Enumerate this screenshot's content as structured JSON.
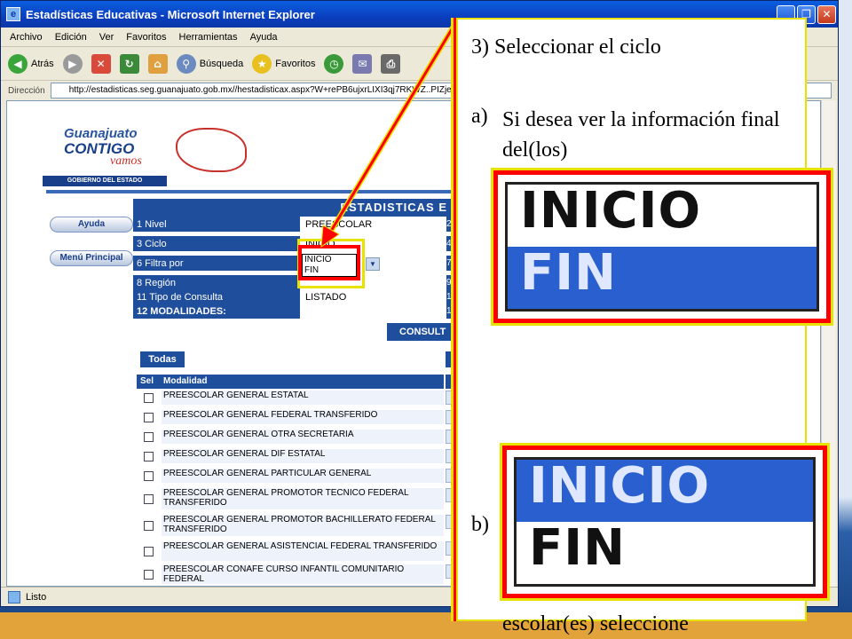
{
  "window": {
    "title": "Estadísticas Educativas - Microsoft Internet Explorer",
    "buttons": {
      "minimize": "_",
      "restore": "❐",
      "close": "✕"
    }
  },
  "menu": [
    "Archivo",
    "Edición",
    "Ver",
    "Favoritos",
    "Herramientas",
    "Ayuda"
  ],
  "toolbar": {
    "back": "Atrás",
    "search": "Búsqueda",
    "favorites": "Favoritos"
  },
  "address": {
    "label": "Dirección",
    "url": "http://estadisticas.seg.guanajuato.gob.mx//hestadisticax.aspx?W+rePB6ujxrLIXI3qj7RKWZ..PIZje..."
  },
  "status": {
    "text": "Listo"
  },
  "site": {
    "logo_line1": "Guanajuato",
    "logo_line2": "CONTIGO",
    "logo_line3": "vamos",
    "logo_gov": "GOBIERNO DEL ESTADO",
    "help": "Ayuda",
    "main_menu": "Menú Principal",
    "header": "ESTADISTICAS E"
  },
  "form": [
    {
      "label": "1 Nivel",
      "value": "PREESCOLAR",
      "num": "2"
    },
    {
      "label": "3 Ciclo",
      "value": "INICIO",
      "num": "4"
    },
    {
      "label": "6 Filtra por",
      "value": "",
      "num": "7"
    },
    {
      "label": "8 Región",
      "value": "",
      "num": "9"
    },
    {
      "label": "11 Tipo de Consulta",
      "value": "LISTADO",
      "num": "1"
    },
    {
      "label": "12 MODALIDADES:",
      "value": "",
      "num": "1"
    }
  ],
  "dropdown": {
    "options": [
      "INICIO",
      "FIN"
    ]
  },
  "consult_button": "CONSULT",
  "all_button": "Todas",
  "mod_table": {
    "col_sel": "Sel",
    "col_mod": "Modalidad",
    "rows": [
      "PREESCOLAR GENERAL ESTATAL",
      "PREESCOLAR GENERAL FEDERAL TRANSFERIDO",
      "PREESCOLAR GENERAL OTRA SECRETARIA",
      "PREESCOLAR GENERAL DIF ESTATAL",
      "PREESCOLAR GENERAL PARTICULAR GENERAL",
      "PREESCOLAR GENERAL PROMOTOR TECNICO FEDERAL TRANSFERIDO",
      "PREESCOLAR GENERAL PROMOTOR BACHILLERATO FEDERAL TRANSFERIDO",
      "PREESCOLAR GENERAL ASISTENCIAL FEDERAL TRANSFERIDO",
      "PREESCOLAR CONAFE CURSO INFANTIL COMUNITARIO FEDERAL"
    ]
  },
  "slide": {
    "step": "3) Seleccionar el ciclo",
    "a_letter": "a)",
    "a_text": "Si desea ver la información final del(los)",
    "b_letter": "b)",
    "b_tail": "escolar(es) seleccione",
    "zoom_options": [
      "INICIO",
      "FIN"
    ],
    "colors": {
      "highlight": "#ff0000",
      "outline": "#e7e200",
      "select": "#2a5fd0"
    }
  }
}
